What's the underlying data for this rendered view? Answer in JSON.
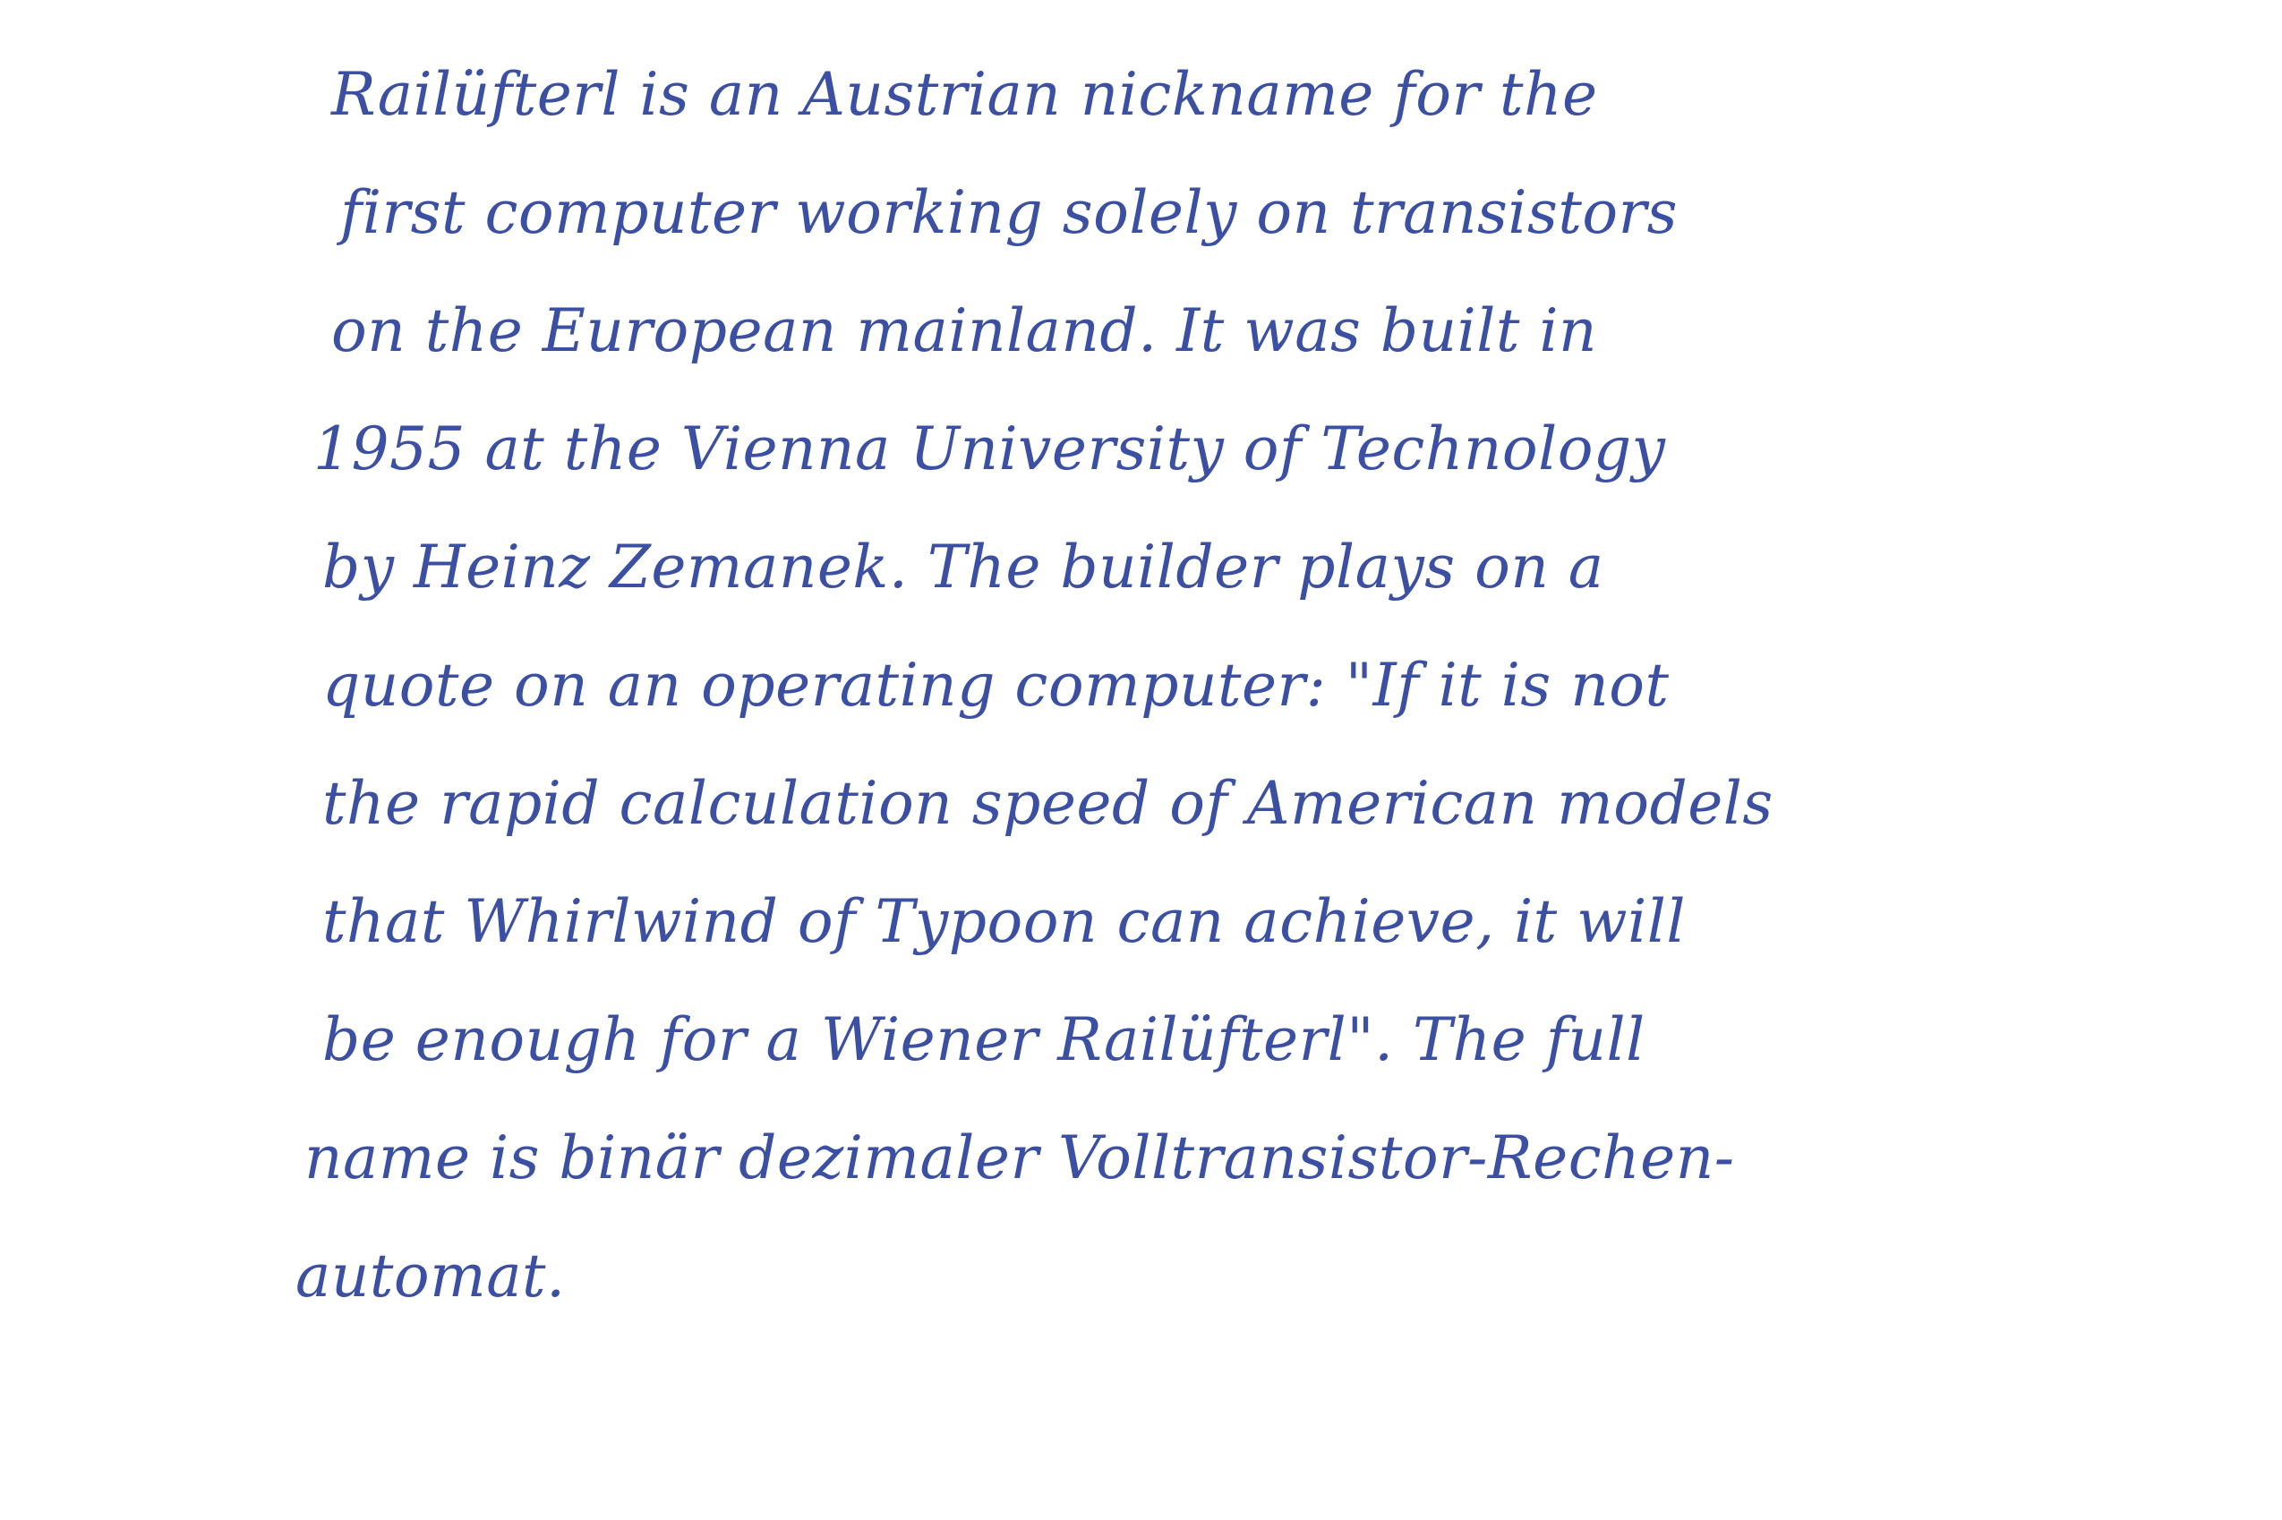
{
  "document": {
    "lines": [
      "Railüfterl is an Austrian nickname for the",
      "first computer working solely on transistors",
      "on the European mainland. It was built in",
      "1955 at the Vienna University of Technology",
      "by Heinz Zemanek. The builder plays on a",
      "quote on an operating computer: \"If it is not",
      "the rapid calculation speed of American models",
      "that Whirlwind of Typoon can achieve, it will",
      "be enough for a Wiener Railüfterl\". The full",
      "name is binär dezimaler Volltransistor-Rechen-",
      "automat."
    ],
    "ink_color": "#3b4fa3",
    "paper_color": "#ffffff"
  }
}
